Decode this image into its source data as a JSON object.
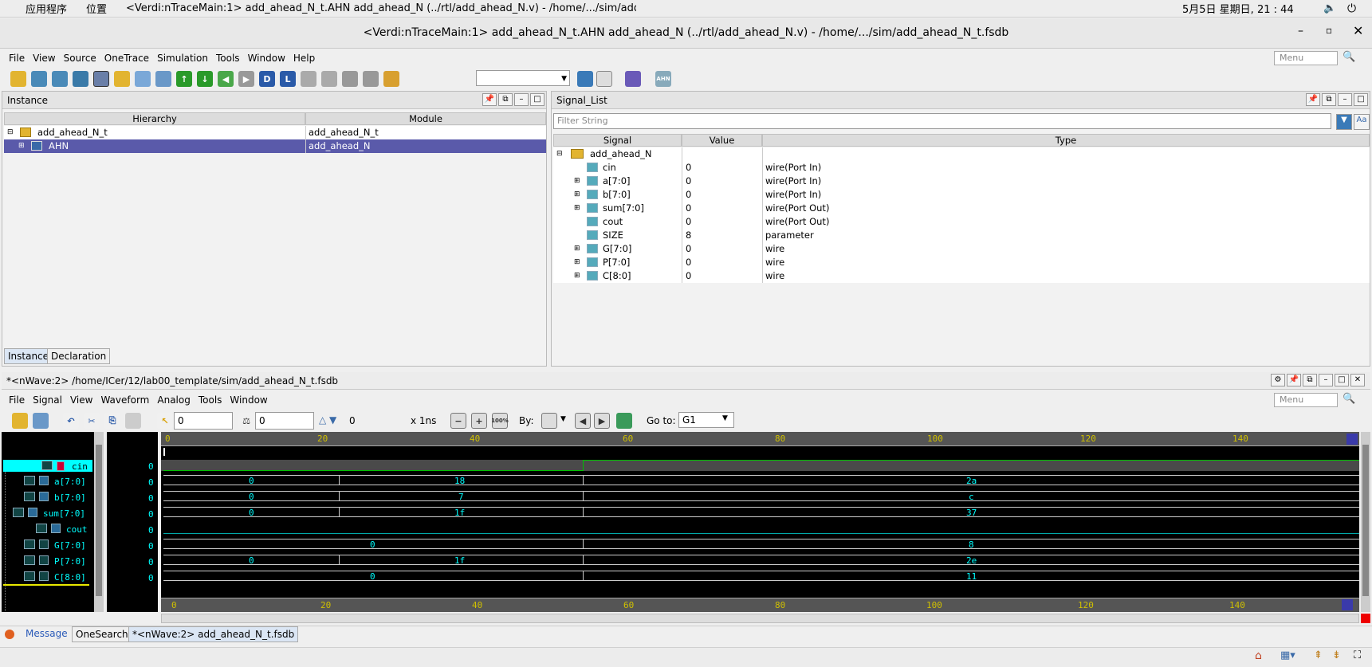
{
  "topbar": {
    "apps": "应用程序",
    "places": "位置",
    "window_title": "<Verdi:nTraceMain:1> add_ahead_N_t.AHN add_ahead_N (../rtl/add_ahead_N.v) - /home/.../sim/add_ah···",
    "clock": "5月5日 星期日, 21 : 44"
  },
  "titlebar": {
    "title": "<Verdi:nTraceMain:1> add_ahead_N_t.AHN add_ahead_N (../rtl/add_ahead_N.v) - /home/.../sim/add_ahead_N_t.fsdb"
  },
  "main_menu": {
    "items": [
      "File",
      "View",
      "Source",
      "OneTrace",
      "Simulation",
      "Tools",
      "Window",
      "Help"
    ],
    "search_placeholder": "Menu"
  },
  "instance_panel": {
    "title": "Instance",
    "col_hierarchy": "Hierarchy",
    "col_module": "Module",
    "rows": [
      {
        "name": "add_ahead_N_t",
        "module": "add_ahead_N_t"
      },
      {
        "name": "AHN",
        "module": "add_ahead_N"
      }
    ],
    "tabs": [
      "Instance",
      "Declaration"
    ]
  },
  "signal_panel": {
    "title": "Signal_List",
    "filter_placeholder": "Filter String",
    "col_signal": "Signal",
    "col_value": "Value",
    "col_type": "Type",
    "group": "add_ahead_N",
    "rows": [
      {
        "name": "cin",
        "value": "0",
        "type": "wire(Port In)"
      },
      {
        "name": "a[7:0]",
        "value": "0",
        "type": "wire(Port In)"
      },
      {
        "name": "b[7:0]",
        "value": "0",
        "type": "wire(Port In)"
      },
      {
        "name": "sum[7:0]",
        "value": "0",
        "type": "wire(Port Out)"
      },
      {
        "name": "cout",
        "value": "0",
        "type": "wire(Port Out)"
      },
      {
        "name": "SIZE",
        "value": "8",
        "type": "parameter"
      },
      {
        "name": "G[7:0]",
        "value": "0",
        "type": "wire"
      },
      {
        "name": "P[7:0]",
        "value": "0",
        "type": "wire"
      },
      {
        "name": "C[8:0]",
        "value": "0",
        "type": "wire"
      }
    ]
  },
  "nwave": {
    "title": "*<nWave:2> /home/ICer/12/lab00_template/sim/add_ahead_N_t.fsdb",
    "menu": [
      "File",
      "Signal",
      "View",
      "Waveform",
      "Analog",
      "Tools",
      "Window"
    ],
    "search_placeholder": "Menu",
    "cursor_time": "0",
    "marker_time": "0",
    "delta": "0",
    "scale": "x 1ns",
    "by_label": "By:",
    "goto_label": "Go to:",
    "goto_value": "G1",
    "ruler_ticks": [
      "0",
      "20",
      "40",
      "60",
      "80",
      "100",
      "120",
      "140"
    ],
    "signals": [
      {
        "name": "cin",
        "value": "0"
      },
      {
        "name": "a[7:0]",
        "value": "0"
      },
      {
        "name": "b[7:0]",
        "value": "0"
      },
      {
        "name": "sum[7:0]",
        "value": "0"
      },
      {
        "name": "cout",
        "value": "0"
      },
      {
        "name": "G[7:0]",
        "value": "0"
      },
      {
        "name": "P[7:0]",
        "value": "0"
      },
      {
        "name": "C[8:0]",
        "value": "0"
      }
    ],
    "bus_values": {
      "a": [
        "0",
        "18",
        "2a"
      ],
      "b": [
        "0",
        "7",
        "c"
      ],
      "sum": [
        "0",
        "1f",
        "37"
      ],
      "G": [
        "0",
        "8"
      ],
      "P": [
        "0",
        "1f",
        "2e"
      ],
      "C": [
        "0",
        "11"
      ]
    }
  },
  "bottom_tabs": [
    "Message",
    "OneSearch",
    "*<nWave:2> add_ahead_N_t.fsdb"
  ],
  "colors": {
    "selection": "#5a5aaa",
    "wave_cyan": "#00ffff",
    "wave_green": "#00c000",
    "ruler_yellow": "#d0c000"
  }
}
